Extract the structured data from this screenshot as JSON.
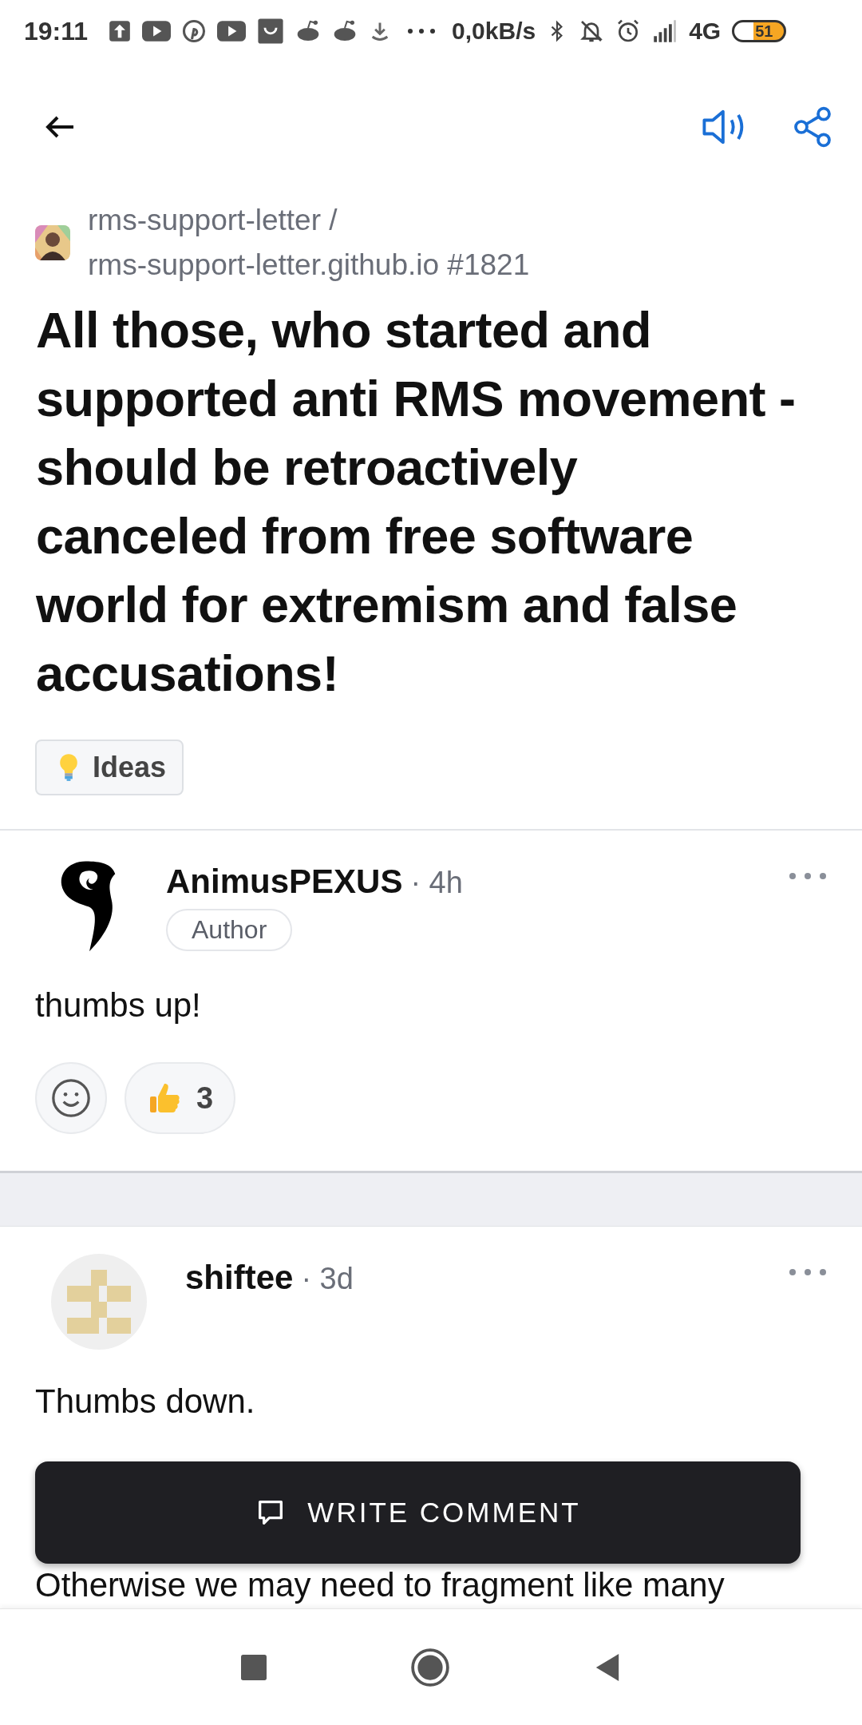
{
  "status_bar": {
    "time": "19:11",
    "network_speed": "0,0kB/s",
    "network_type": "4G",
    "battery": "51"
  },
  "repository": {
    "owner": "rms-support-letter /",
    "name": "rms-support-letter.github.io #1821"
  },
  "title": "All those, who started and supported anti RMS movement - should be retroactively canceled from free software world for extremism and false accusations!",
  "category": {
    "label": "Ideas"
  },
  "comments": [
    {
      "author": "AnimusPEXUS",
      "time": "· 4h",
      "badge": "Author",
      "avatar": {
        "kind": "glyph"
      },
      "body": [
        "thumbs up!"
      ],
      "reactions": [
        {
          "count": "3"
        }
      ]
    },
    {
      "author": "shiftee",
      "time": "· 3d",
      "avatar": {
        "kind": "identicon"
      },
      "body": [
        "Thumbs down.",
        "Otherwise we may need to fragment like many"
      ]
    }
  ],
  "write_button": {
    "label": "WRITE COMMENT"
  }
}
